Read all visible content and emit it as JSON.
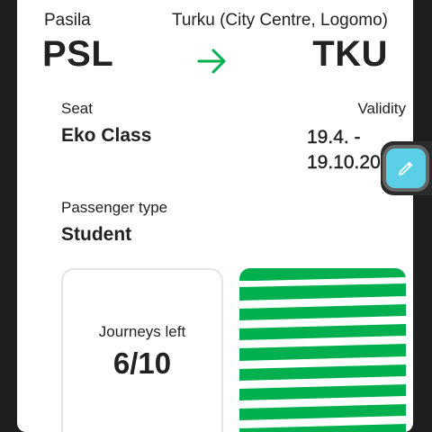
{
  "ticket": {
    "from_name": "Pasila",
    "from_code": "PSL",
    "to_name": "Turku (City Centre, Logomo)",
    "to_code": "TKU",
    "arrow_icon": "arrow-right-icon",
    "seat_label": "Seat",
    "seat_value": "Eko Class",
    "validity_label": "Validity",
    "validity_value_line1": "19.4. -",
    "validity_value_line2": "19.10.2025",
    "passenger_label": "Passenger type",
    "passenger_value": "Student",
    "journeys_label": "Journeys left",
    "journeys_value": "6/10"
  },
  "overlay": {
    "edit_icon": "eyedropper-icon"
  },
  "colors": {
    "accent_green": "#00b04f",
    "edit_button": "#5bcfe6",
    "text": "#222222",
    "card_background": "#ffffff",
    "screen_background": "#1e1e1e"
  }
}
